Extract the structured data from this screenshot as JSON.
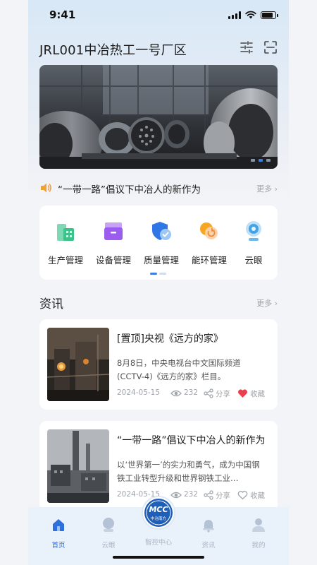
{
  "status": {
    "time": "9:41"
  },
  "header": {
    "title": "JRL001中冶热工一号厂区"
  },
  "notice": {
    "text": "“一带一路”倡议下中冶人的新作为",
    "more": "更多"
  },
  "menu": {
    "items": [
      {
        "label": "生产管理",
        "icon": "building-icon"
      },
      {
        "label": "设备管理",
        "icon": "toolbox-icon"
      },
      {
        "label": "质量管理",
        "icon": "shield-check-icon"
      },
      {
        "label": "能环管理",
        "icon": "energy-icon"
      },
      {
        "label": "云眼",
        "icon": "camera-icon"
      }
    ]
  },
  "news_section": {
    "title": "资讯",
    "more": "更多"
  },
  "news": [
    {
      "title": "[置顶]央视《远方的家》",
      "desc": "8月8日，中央电视台中文国际频道(CCTV-4)《远方的家》栏目。",
      "date": "2024-05-15",
      "views": "232",
      "share": "分享",
      "collect": "收藏",
      "collected": true
    },
    {
      "title": "“一带一路”倡议下中冶人的新作为",
      "desc": "以‘世界第一’的实力和勇气，成为中国钢 铁工业转型升级和世界钢铁工业…",
      "date": "2024-05-15",
      "views": "232",
      "share": "分享",
      "collect": "收藏",
      "collected": false
    }
  ],
  "tabbar": {
    "items": [
      {
        "label": "首页",
        "active": true
      },
      {
        "label": "云眼"
      },
      {
        "label": "智控中心"
      },
      {
        "label": "资讯"
      },
      {
        "label": "我的"
      }
    ],
    "logo_text": "MCC",
    "logo_sub": "中冶南方"
  },
  "colors": {
    "accent": "#2f6fdc",
    "heart": "#e8404f"
  }
}
